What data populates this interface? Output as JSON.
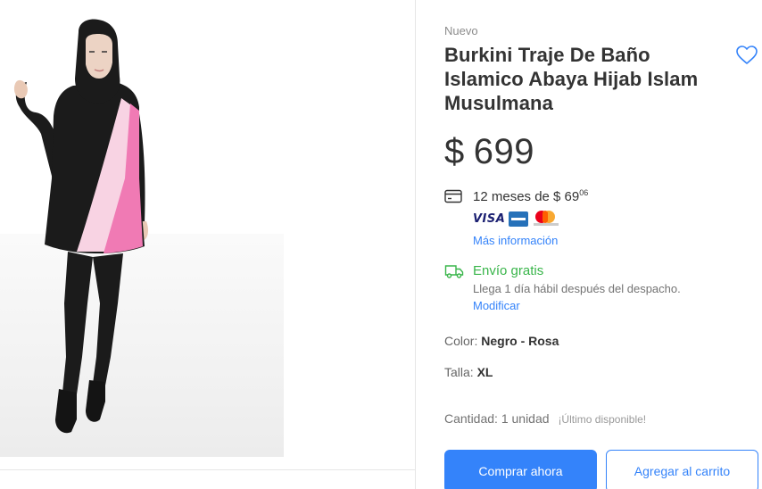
{
  "listing": {
    "condition": "Nuevo",
    "title": "Burkini Traje De Baño Islamico Abaya Hijab Islam Musulmana",
    "price_currency": "$",
    "price_amount": "699"
  },
  "installments": {
    "text": "12 meses de $ 69",
    "cents": "06",
    "payment_methods": [
      "VISA",
      "american-express-icon",
      "mastercard-icon"
    ],
    "more_info": "Más información"
  },
  "shipping": {
    "title": "Envío gratis",
    "subtitle": "Llega 1 día hábil después del despacho.",
    "modify": "Modificar"
  },
  "attributes": {
    "color_label": "Color:",
    "color_value": "Negro - Rosa",
    "size_label": "Talla:",
    "size_value": "XL"
  },
  "quantity": {
    "text": "Cantidad: 1 unidad",
    "availability": "¡Último disponible!"
  },
  "actions": {
    "buy_now": "Comprar ahora",
    "add_to_cart": "Agregar al carrito"
  },
  "colors": {
    "accent": "#3483fa",
    "success": "#39b54a",
    "garment_black": "#1b1b1b",
    "garment_pink": "#f07ab4",
    "garment_light_pink": "#f8d3e3"
  }
}
